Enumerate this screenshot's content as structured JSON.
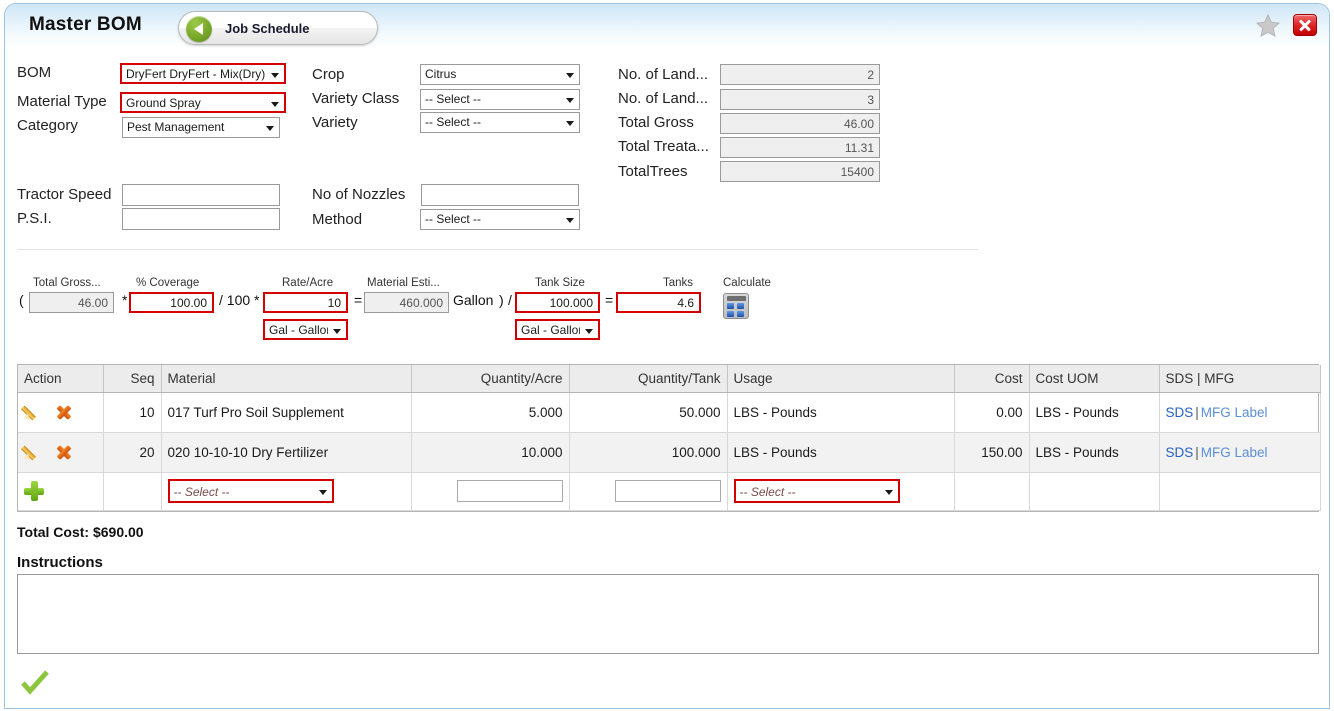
{
  "window": {
    "title": "Master BOM",
    "nav_button": {
      "label": "Job Schedule",
      "icon": "back-arrow-icon"
    },
    "favorite_icon": "star-icon",
    "close_icon": "close-icon"
  },
  "form": {
    "left": [
      {
        "label": "BOM",
        "type": "select",
        "value": "DryFert DryFert - Mix(Dry)",
        "highlight": "#d40000"
      },
      {
        "label": "Material Type",
        "type": "select",
        "value": "Ground Spray",
        "highlight": "#d40000"
      },
      {
        "label": "Category",
        "type": "select",
        "value": "Pest Management",
        "highlight": ""
      }
    ],
    "middle": [
      {
        "label": "Crop",
        "type": "select",
        "value": "Citrus"
      },
      {
        "label": "Variety Class",
        "type": "select",
        "value": "-- Select --"
      },
      {
        "label": "Variety",
        "type": "select",
        "value": "-- Select --"
      }
    ],
    "right": [
      {
        "label": "No. of Land...",
        "value": "2",
        "readonly": true
      },
      {
        "label": "No. of Land...",
        "value": "3",
        "readonly": true
      },
      {
        "label": "Total Gross",
        "value": "46.00",
        "readonly": true
      },
      {
        "label": "Total Treata...",
        "value": "11.31",
        "readonly": true
      },
      {
        "label": "TotalTrees",
        "value": "15400",
        "readonly": true
      }
    ],
    "row2_left": [
      {
        "label": "Tractor Speed",
        "type": "text",
        "value": ""
      },
      {
        "label": "P.S.I.",
        "type": "text",
        "value": ""
      }
    ],
    "row2_mid": [
      {
        "label": "No of Nozzles",
        "type": "text",
        "value": ""
      },
      {
        "label": "Method",
        "type": "select",
        "value": "-- Select --"
      }
    ]
  },
  "calc": {
    "open_paren": "(",
    "close_paren": ")",
    "total_gross": {
      "caption": "Total Gross...",
      "value": "46.00"
    },
    "op1": "*",
    "coverage": {
      "caption": "% Coverage",
      "value": "100.00"
    },
    "op2": "/ 100 *",
    "rate_acre": {
      "caption": "Rate/Acre",
      "value": "10",
      "uom": "Gal - Gallon"
    },
    "op3": "=",
    "material_est": {
      "caption": "Material Esti...",
      "value": "460.000",
      "unit": "Gallon"
    },
    "op4": "/",
    "tank_size": {
      "caption": "Tank Size",
      "value": "100.000",
      "uom": "Gal - Gallon"
    },
    "op5": "=",
    "tanks": {
      "caption": "Tanks",
      "value": "4.6"
    },
    "calculate": {
      "caption": "Calculate",
      "icon": "calculator-icon"
    }
  },
  "grid": {
    "columns": [
      {
        "label": "Action",
        "align": "left"
      },
      {
        "label": "Seq",
        "align": "right"
      },
      {
        "label": "Material",
        "align": "left"
      },
      {
        "label": "Quantity/Acre",
        "align": "right"
      },
      {
        "label": "Quantity/Tank",
        "align": "right"
      },
      {
        "label": "Usage",
        "align": "left"
      },
      {
        "label": "Cost",
        "align": "right"
      },
      {
        "label": "Cost UOM",
        "align": "left"
      },
      {
        "label": "SDS | MFG",
        "align": "left"
      }
    ],
    "rows": [
      {
        "seq": "10",
        "material": "017 Turf Pro Soil Supplement",
        "qty_acre": "5.000",
        "qty_tank": "50.000",
        "usage": "LBS - Pounds",
        "cost": "0.00",
        "cost_uom": "LBS - Pounds",
        "sds": "SDS",
        "mfg": "MFG Label"
      },
      {
        "seq": "20",
        "material": "020 10-10-10 Dry Fertilizer",
        "qty_acre": "10.000",
        "qty_tank": "100.000",
        "usage": "LBS - Pounds",
        "cost": "150.00",
        "cost_uom": "LBS - Pounds",
        "sds": "SDS",
        "mfg": "MFG Label"
      }
    ],
    "new_row": {
      "material_placeholder": "-- Select --",
      "qty_acre": "",
      "qty_tank": "",
      "usage_placeholder": "-- Select --"
    },
    "sds_separator": "|"
  },
  "footer": {
    "total_cost": "Total Cost: $690.00",
    "instructions_label": "Instructions",
    "instructions_value": "",
    "save_icon": "green-check-icon"
  }
}
